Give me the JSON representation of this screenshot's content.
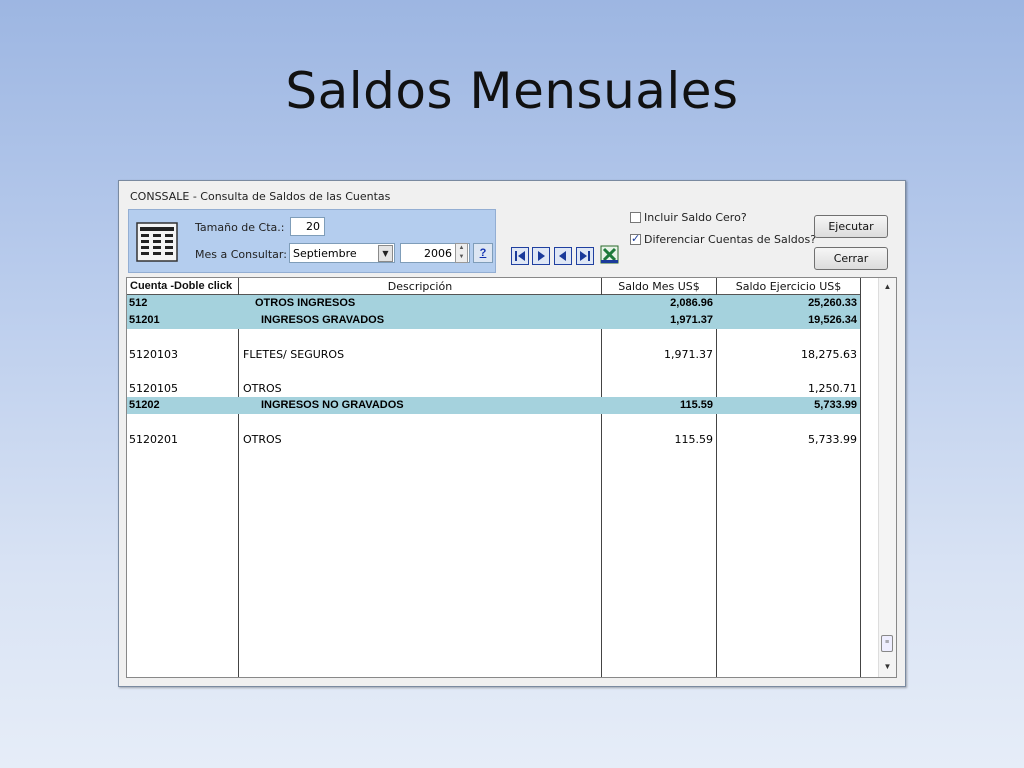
{
  "slide": {
    "title": "Saldos Mensuales"
  },
  "window": {
    "title": "CONSSALE - Consulta de Saldos de las Cuentas"
  },
  "form": {
    "tamano_label": "Tamaño de Cta.:",
    "tamano_value": "20",
    "mes_label": "Mes a Consultar:",
    "mes_value": "Septiembre",
    "year_value": "2006",
    "help_label": "?"
  },
  "options": {
    "incluir_saldo_cero": {
      "label": "Incluir Saldo Cero?",
      "checked": false
    },
    "diferenciar_cuentas": {
      "label": "Diferenciar Cuentas de Saldos?",
      "checked": true
    }
  },
  "buttons": {
    "ejecutar": "Ejecutar",
    "cerrar": "Cerrar"
  },
  "nav_icons": [
    "first-record-icon",
    "next-record-icon",
    "previous-record-icon",
    "last-record-icon",
    "excel-export-icon"
  ],
  "table": {
    "headers": [
      "Cuenta -Doble click",
      "Descripción",
      "Saldo Mes US$",
      "Saldo Ejercicio US$"
    ],
    "rows": [
      {
        "cuenta": "512",
        "descripcion": "OTROS INGRESOS",
        "saldo_mes": "2,086.96",
        "saldo_ejercicio": "25,260.33",
        "group": true
      },
      {
        "cuenta": "51201",
        "descripcion": "INGRESOS GRAVADOS",
        "saldo_mes": "1,971.37",
        "saldo_ejercicio": "19,526.34",
        "group": true
      },
      {
        "cuenta": "",
        "descripcion": "",
        "saldo_mes": "",
        "saldo_ejercicio": "",
        "group": false
      },
      {
        "cuenta": "5120103",
        "descripcion": "FLETES/ SEGUROS",
        "saldo_mes": "1,971.37",
        "saldo_ejercicio": "18,275.63",
        "group": false
      },
      {
        "cuenta": "",
        "descripcion": "",
        "saldo_mes": "",
        "saldo_ejercicio": "",
        "group": false
      },
      {
        "cuenta": "5120105",
        "descripcion": "OTROS",
        "saldo_mes": "",
        "saldo_ejercicio": "1,250.71",
        "group": false
      },
      {
        "cuenta": "51202",
        "descripcion": "INGRESOS NO GRAVADOS",
        "saldo_mes": "115.59",
        "saldo_ejercicio": "5,733.99",
        "group": true
      },
      {
        "cuenta": "",
        "descripcion": "",
        "saldo_mes": "",
        "saldo_ejercicio": "",
        "group": false
      },
      {
        "cuenta": "5120201",
        "descripcion": "OTROS",
        "saldo_mes": "115.59",
        "saldo_ejercicio": "5,733.99",
        "group": false
      }
    ]
  },
  "colors": {
    "group_row": "#a5d2dd",
    "panel": "#b4cdee",
    "nav_blue": "#1a3a9a"
  }
}
